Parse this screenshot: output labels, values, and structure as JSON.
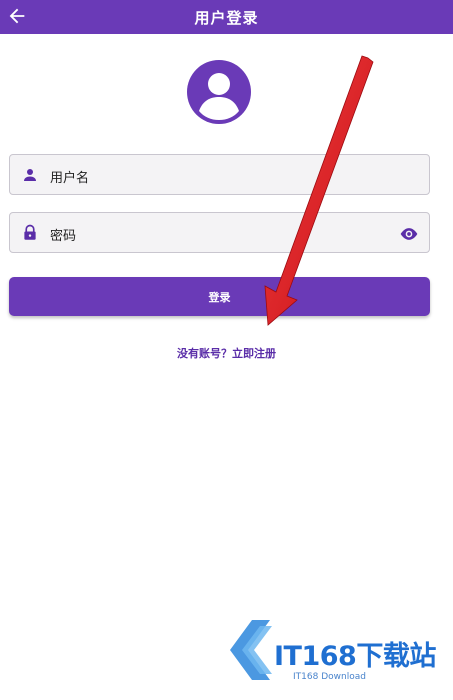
{
  "appbar": {
    "title": "用户登录",
    "back_icon": "arrow-left-icon"
  },
  "avatar": {
    "icon": "account-circle-icon"
  },
  "username_field": {
    "placeholder": "用户名",
    "icon": "person-icon"
  },
  "password_field": {
    "placeholder": "密码",
    "icon": "lock-icon",
    "toggle_icon": "eye-icon"
  },
  "login_button": {
    "label": "登录"
  },
  "register_link": {
    "label": "没有账号？立即注册"
  },
  "watermark": {
    "brand": "IT168下载站",
    "subtitle": "IT168 Download"
  },
  "colors": {
    "primary": "#6a3ab7",
    "field_bg": "#f4f3f5",
    "annotation_arrow": "#e0121b",
    "watermark": "#1f6fd1"
  }
}
